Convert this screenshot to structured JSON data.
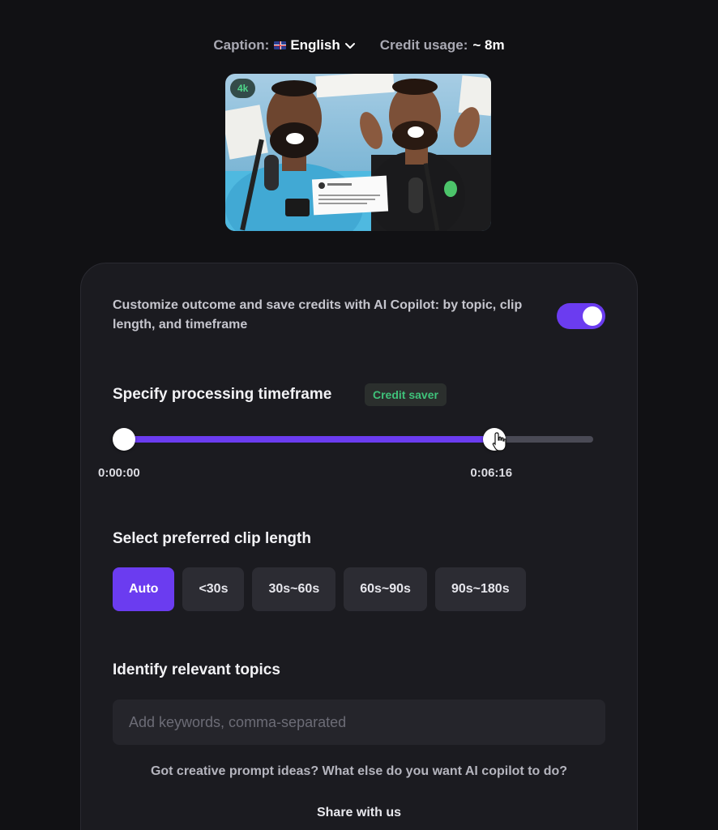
{
  "header": {
    "caption_label": "Caption:",
    "caption_language": "English",
    "credit_label": "Credit usage:",
    "credit_value": "~ 8m"
  },
  "thumbnail": {
    "badge": "4k"
  },
  "copilot": {
    "description": "Customize outcome and save credits with AI Copilot: by topic, clip length, and timeframe",
    "toggle_on": true
  },
  "timeframe": {
    "title": "Specify processing timeframe",
    "badge": "Credit saver",
    "start_label": "0:00:00",
    "end_label": "0:06:16",
    "selected_fraction_start": 0.0,
    "selected_fraction_end": 0.79
  },
  "clip_length": {
    "title": "Select preferred clip length",
    "options": [
      "Auto",
      "<30s",
      "30s~60s",
      "60s~90s",
      "90s~180s"
    ],
    "selected": "Auto"
  },
  "topics": {
    "title": "Identify relevant topics",
    "placeholder": "Add keywords, comma-separated",
    "value": ""
  },
  "feedback": {
    "prompt": "Got creative prompt ideas? What else do you want AI copilot to do?",
    "link": "Share with us"
  },
  "colors": {
    "accent": "#6b3cf0",
    "credit_green": "#3fc27a",
    "background": "#111114",
    "card": "#1b1b20"
  },
  "icons": {
    "language_dropdown": "chevron-down-icon",
    "flag": "uk-flag-icon",
    "cursor": "hand-pointer-icon"
  }
}
